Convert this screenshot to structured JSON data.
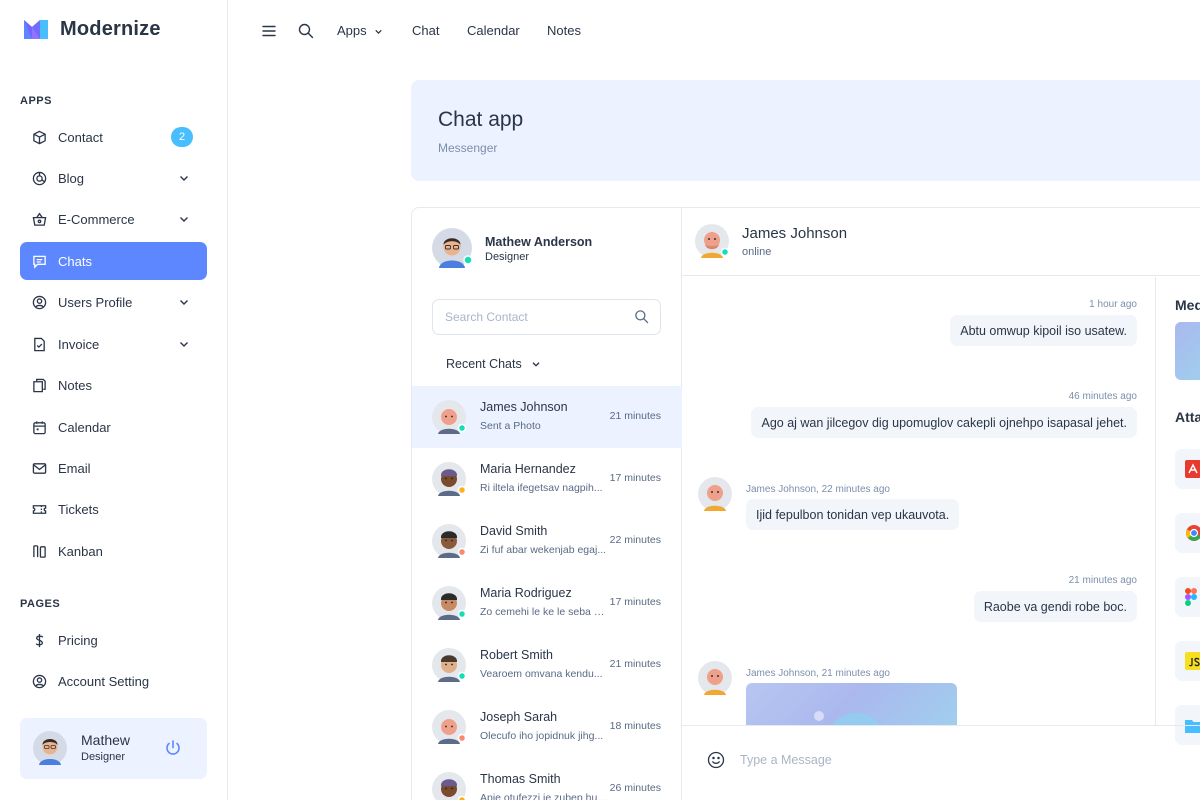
{
  "app": {
    "name": "Modernize"
  },
  "sidebar": {
    "apps_caption": "APPS",
    "pages_caption": "PAGES",
    "items": [
      {
        "label": "Contact",
        "icon": "cube-icon",
        "badge": "2"
      },
      {
        "label": "Blog",
        "icon": "chart-donut-icon"
      },
      {
        "label": "E-Commerce",
        "icon": "basket-icon"
      },
      {
        "label": "Chats",
        "icon": "message-icon",
        "active": true
      },
      {
        "label": "Users Profile",
        "icon": "user-circle-icon"
      },
      {
        "label": "Invoice",
        "icon": "file-check-icon"
      },
      {
        "label": "Notes",
        "icon": "notes-icon"
      },
      {
        "label": "Calendar",
        "icon": "calendar-icon"
      },
      {
        "label": "Email",
        "icon": "mail-icon"
      },
      {
        "label": "Tickets",
        "icon": "ticket-icon"
      },
      {
        "label": "Kanban",
        "icon": "kanban-icon"
      }
    ],
    "pages": [
      {
        "label": "Pricing",
        "icon": "dollar-icon"
      },
      {
        "label": "Account Setting",
        "icon": "user-circle-icon"
      }
    ],
    "profile": {
      "name": "Mathew",
      "role": "Designer"
    }
  },
  "topbar": {
    "links": {
      "apps": "Apps",
      "chat": "Chat",
      "calendar": "Calendar",
      "notes": "Notes"
    }
  },
  "banner": {
    "title": "Chat app",
    "subtitle": "Messenger"
  },
  "chat": {
    "me": {
      "name": "Mathew Anderson",
      "role": "Designer"
    },
    "search_placeholder": "Search Contact",
    "recent_label": "Recent Chats",
    "contacts": [
      {
        "name": "James Johnson",
        "message": "Sent a Photo",
        "time": "21 minutes",
        "status_color": "#13deb9"
      },
      {
        "name": "Maria Hernandez",
        "message": "Ri iltela ifegetsav nagpih...",
        "time": "17 minutes",
        "status_color": "#ffae1f"
      },
      {
        "name": "David Smith",
        "message": "Zi fuf abar wekenjab egaj...",
        "time": "22 minutes",
        "status_color": "#fa896b"
      },
      {
        "name": "Maria Rodriguez",
        "message": "Zo cemehi le ke le seba zo...",
        "time": "17 minutes",
        "status_color": "#13deb9"
      },
      {
        "name": "Robert Smith",
        "message": "Vearoem omvana kendu...",
        "time": "21 minutes",
        "status_color": "#13deb9"
      },
      {
        "name": "Joseph Sarah",
        "message": "Olecufo iho jopidnuk jihg...",
        "time": "18 minutes",
        "status_color": "#fa896b"
      },
      {
        "name": "Thomas Smith",
        "message": "Apie otufezzi ie zubep hu...",
        "time": "26 minutes",
        "status_color": "#ffae1f"
      }
    ],
    "active_contact": {
      "name": "James Johnson",
      "status": "online"
    },
    "messages": [
      {
        "time": "1 hour ago",
        "text": "Abtu omwup kipoil iso usatew."
      },
      {
        "time": "46 minutes ago",
        "text": "Ago aj wan jilcegov dig upomuglov cakepli ojnehpo isapasal jehet."
      },
      {
        "time": "James Johnson, 22 minutes ago",
        "text": "Ijid fepulbon tonidan vep ukauvota."
      },
      {
        "time": "21 minutes ago",
        "text": "Raobe va gendi robe boc."
      },
      {
        "time": "James Johnson, 21 minutes ago"
      }
    ],
    "input_placeholder": "Type a Message",
    "side": {
      "media_caption": "Media",
      "attachments_caption": "Attachments"
    }
  }
}
